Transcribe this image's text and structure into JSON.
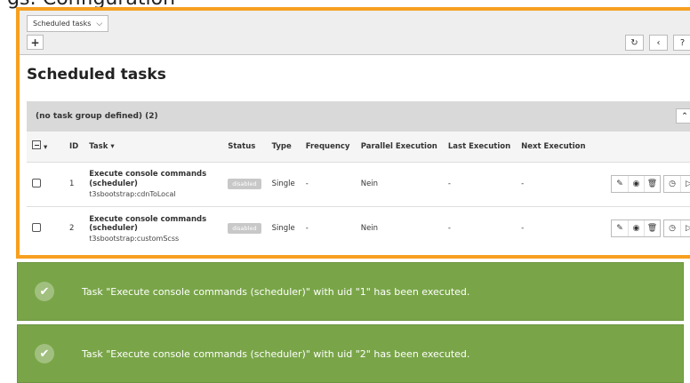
{
  "above_text": "gs: Configuration",
  "toolbar": {
    "module_select": "Scheduled tasks",
    "add_label": "+",
    "reload_icon": "reload-icon",
    "share_icon": "share-icon",
    "help_label": "?"
  },
  "page_title": "Scheduled tasks",
  "group": {
    "title": "(no task group defined) (2)",
    "collapse_icon": "chevron-up-icon"
  },
  "table": {
    "headers": {
      "id": "ID",
      "task": "Task",
      "status": "Status",
      "type": "Type",
      "frequency": "Frequency",
      "parallel": "Parallel Execution",
      "last": "Last Execution",
      "next": "Next Execution"
    },
    "rows": [
      {
        "id": "1",
        "title": "Execute console commands (scheduler)",
        "subtitle": "t3sbootstrap:cdnToLocal",
        "status": "disabled",
        "type": "Single",
        "frequency": "-",
        "parallel": "Nein",
        "last": "-",
        "next": "-"
      },
      {
        "id": "2",
        "title": "Execute console commands (scheduler)",
        "subtitle": "t3sbootstrap:customScss",
        "status": "disabled",
        "type": "Single",
        "frequency": "-",
        "parallel": "Nein",
        "last": "-",
        "next": "-"
      }
    ]
  },
  "alerts": [
    {
      "text": "Task \"Execute console commands (scheduler)\" with uid \"1\" has been executed."
    },
    {
      "text": "Task \"Execute console commands (scheduler)\" with uid \"2\" has been executed."
    }
  ],
  "colors": {
    "highlight_border": "#f7a020",
    "success": "#79a548",
    "group_header": "#d9d9d9"
  }
}
